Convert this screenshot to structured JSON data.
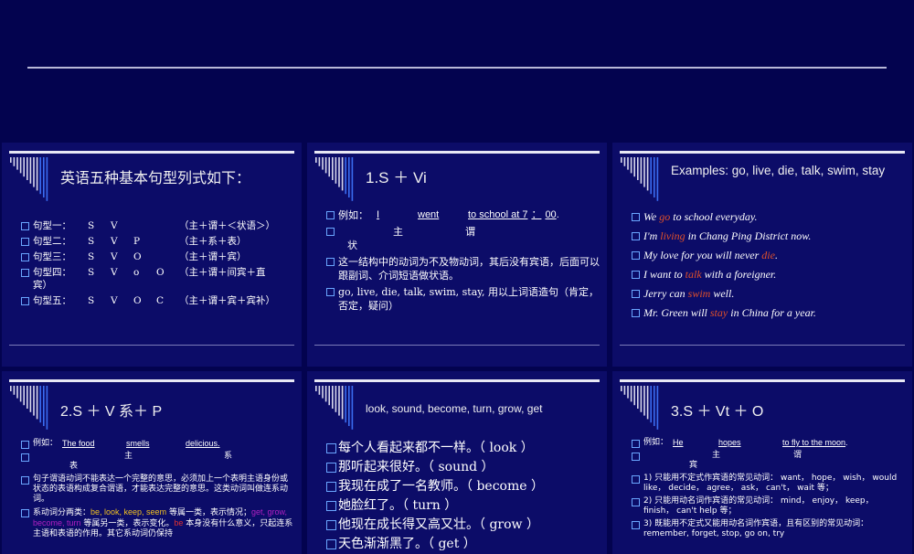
{
  "slides": [
    {
      "title": "英语五种基本句型列式如下：",
      "rows": [
        {
          "label": "句型一：",
          "pattern": [
            "S",
            "V",
            "",
            ""
          ],
          "desc": "（主＋谓＋＜状语＞）"
        },
        {
          "label": "句型二：",
          "pattern": [
            "S",
            "V",
            "P",
            ""
          ],
          "desc": "（主＋系＋表）"
        },
        {
          "label": "句型三：",
          "pattern": [
            "S",
            "V",
            "O",
            ""
          ],
          "desc": "（主＋谓＋宾）"
        },
        {
          "label": "句型四：",
          "pattern": [
            "S",
            "V",
            "o",
            "O"
          ],
          "desc": "（主＋谓＋间宾＋直",
          "desc_cont": "宾）"
        },
        {
          "label": "句型五：",
          "pattern": [
            "S",
            "V",
            "O",
            "C"
          ],
          "desc": "（主＋谓＋宾＋宾补）"
        }
      ]
    },
    {
      "title": "1.S ＋ Vi",
      "example_label": "例如：",
      "example": [
        "I",
        "went",
        "to school at 7",
        "：",
        "00",
        "."
      ],
      "roles": [
        "主",
        "谓",
        "状"
      ],
      "bullets": [
        "这一结构中的动词为不及物动词，其后没有宾语，后面可以跟副词、介词短语做状语。",
        "go, live, die, talk, swim, stay, 用以上词语造句（肯定，否定，疑问）"
      ]
    },
    {
      "title": "Examples: go, live, die, talk, swim, stay",
      "sentences": [
        {
          "pre": "We ",
          "hl": "go",
          "post": " to school everyday."
        },
        {
          "pre": "I'm ",
          "hl": "living",
          "post": " in Chang Ping District now."
        },
        {
          "pre": "My love for you will never ",
          "hl": "die",
          "post": "."
        },
        {
          "pre": "I want to ",
          "hl": "talk",
          "post": " with a foreigner."
        },
        {
          "pre": "Jerry can ",
          "hl": "swim",
          "post": " well."
        },
        {
          "pre": "Mr. Green will ",
          "hl": "stay",
          "post": " in China for a year."
        }
      ]
    },
    {
      "title": "2.S ＋ V 系＋ P",
      "example_label": "例如：",
      "example": [
        "The food",
        "smells",
        "delicious."
      ],
      "roles": [
        "主",
        "系",
        "表"
      ],
      "bullet1": "句子谓语动词不能表达一个完整的意思，必须加上一个表明主语身份或状态的表语构成复合谓语，才能表达完整的意思。这类动词叫做连系动词。",
      "bullet2": {
        "a": "系动词分两类：",
        "b": "be, look, keep, seem",
        "c": " 等属一类，表示情况；",
        "d": "get, grow, become, turn",
        "e": " 等属另一类，表示变化。",
        "f": "be",
        "g": " 本身没有什么意义，只起连系主语和表语的作用。其它系动词仍保持"
      }
    },
    {
      "title": "look, sound, become, turn, grow, get",
      "bullets": [
        "每个人看起来都不一样。（ look ）",
        "那听起来很好。（ sound ）",
        "我现在成了一名教师。（ become ）",
        "她脸红了。（ turn ）",
        "他现在成长得又高又壮。（ grow ）",
        "天色渐渐黑了。（ get ）"
      ]
    },
    {
      "title": "3.S ＋ Vt ＋ O",
      "example_label": "例如：",
      "example": [
        "He",
        "hopes",
        "to fly to the moon",
        "."
      ],
      "roles": [
        "主",
        "谓",
        "宾"
      ],
      "bullets": [
        "1) 只能用不定式作宾语的常见动词： want， hope， wish， would like， decide， agree， ask， can't， wait 等；",
        "2) 只能用动名词作宾语的常见动词： mind， enjoy， keep， finish， can't help 等；",
        "3) 既能用不定式又能用动名词作宾语，且有区别的常见动词： remember, forget, stop, go on, try"
      ]
    }
  ],
  "colors": {
    "background": "#03034f",
    "slide": "#0c0c68",
    "bullet": "#6aa6ff",
    "highlight": "#e0502a"
  }
}
